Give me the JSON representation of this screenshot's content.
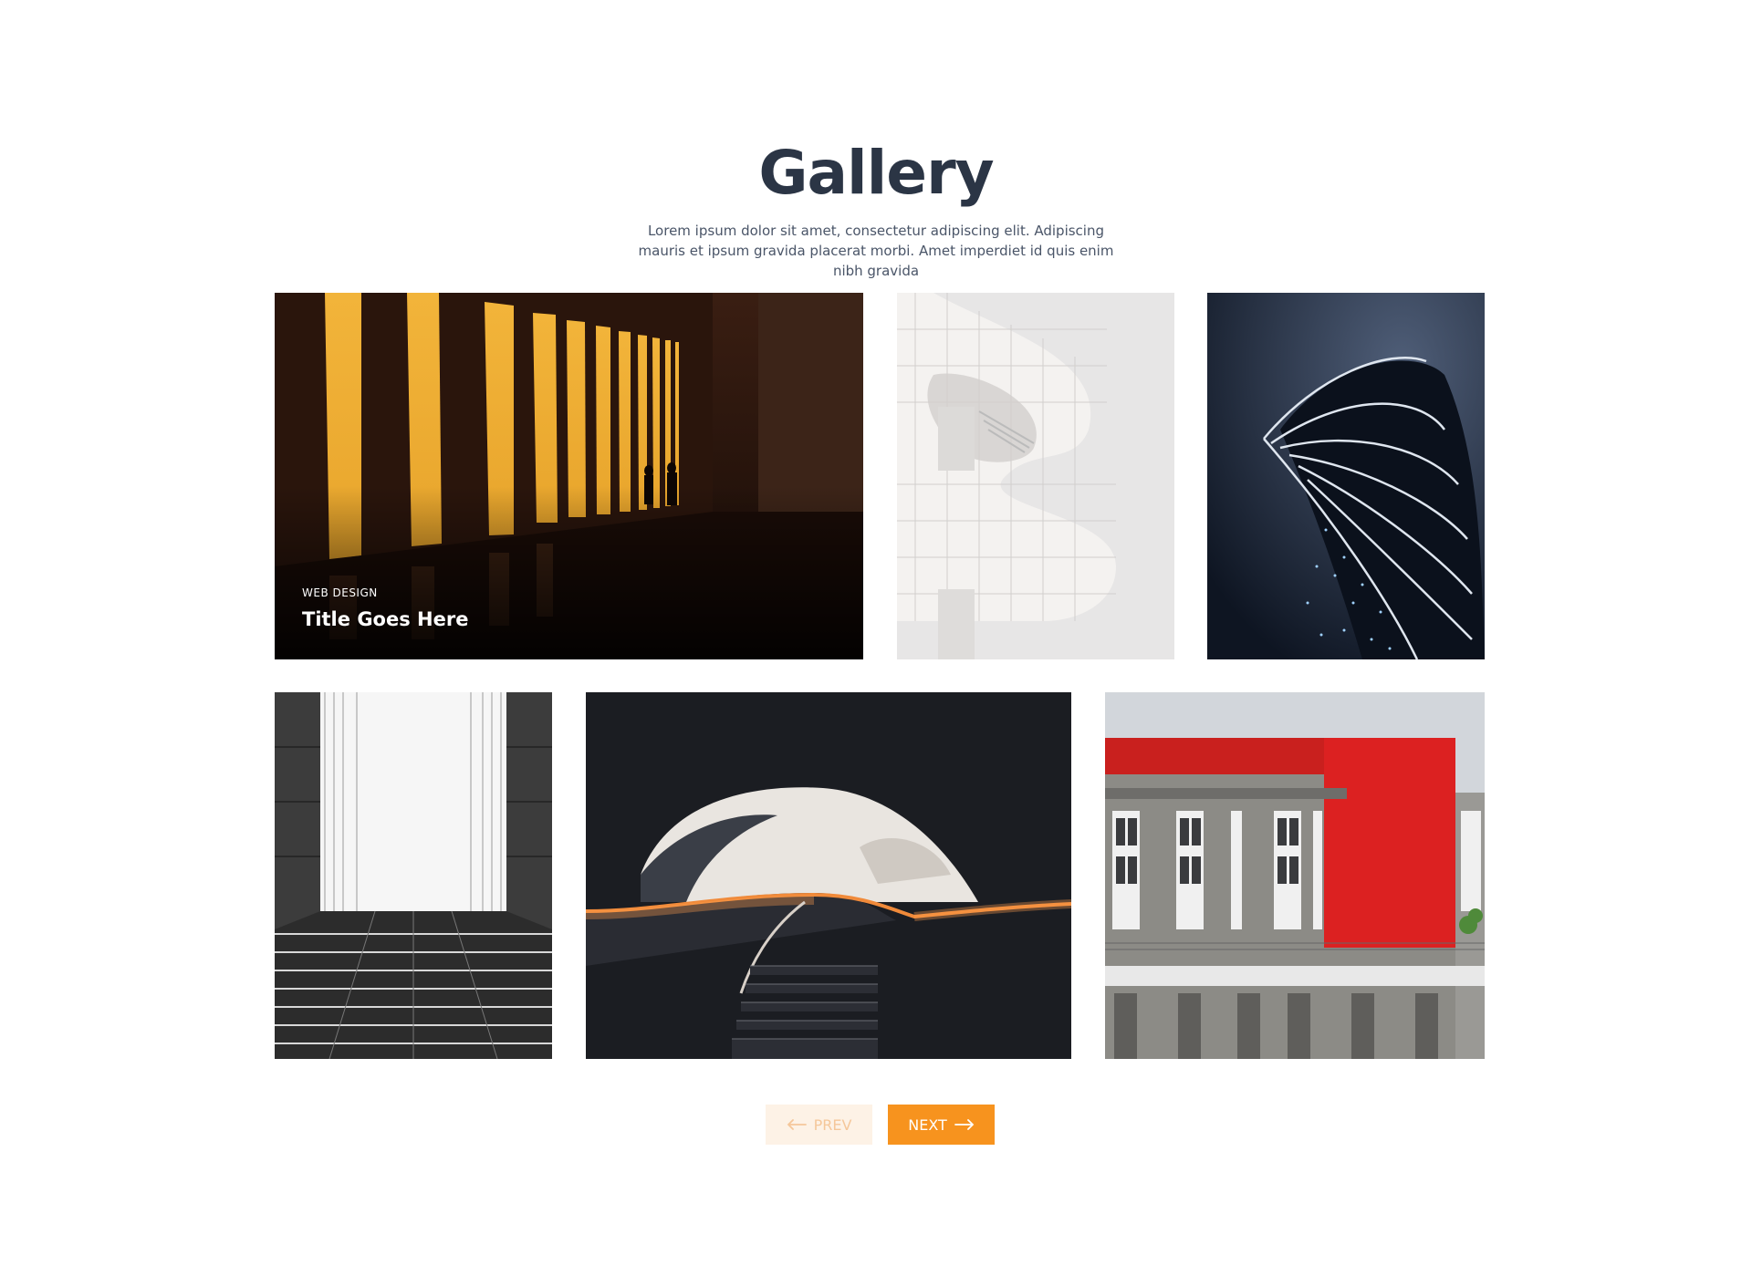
{
  "header": {
    "title": "Gallery",
    "subtitle": "Lorem ipsum dolor sit amet, consectetur adipiscing elit. Adipiscing mauris et ipsum gravida placerat morbi. Amet imperdiet id quis enim nibh gravida"
  },
  "gallery": {
    "featured": {
      "category": "WEB DESIGN",
      "title": "Title Goes Here"
    }
  },
  "pagination": {
    "prev_label": "PREV",
    "next_label": "NEXT"
  },
  "colors": {
    "heading": "#2b3545",
    "accent": "#f7931e",
    "accent_light": "#fdf2e6"
  },
  "icons": {
    "prev": "arrow-left-icon",
    "next": "arrow-right-icon"
  }
}
